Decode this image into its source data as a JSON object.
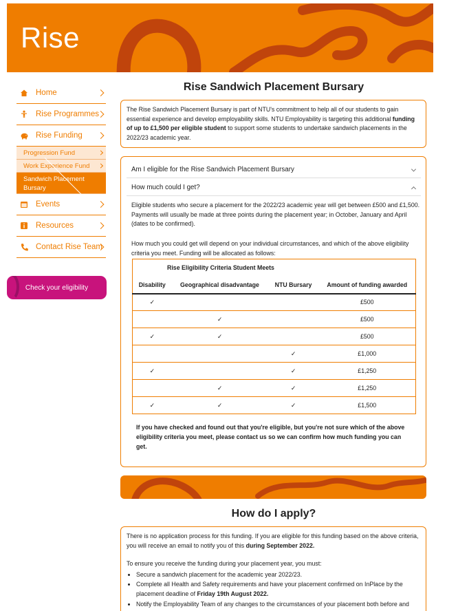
{
  "banner": {
    "title": "Rise"
  },
  "sidebar": {
    "items": [
      {
        "label": "Home",
        "icon": "home-icon"
      },
      {
        "label": "Rise Programmes",
        "icon": "person-icon"
      },
      {
        "label": "Rise Funding",
        "icon": "piggy-bank-icon"
      }
    ],
    "sub_items": [
      {
        "label": "Progression Fund"
      },
      {
        "label": "Work Experience Fund"
      },
      {
        "label": "Sandwich Placement Bursary"
      }
    ],
    "items_after": [
      {
        "label": "Events",
        "icon": "calendar-icon"
      },
      {
        "label": "Resources",
        "icon": "info-icon"
      },
      {
        "label": "Contact Rise Team",
        "icon": "phone-icon"
      }
    ],
    "cta": "Check your eligibility"
  },
  "main": {
    "title": "Rise Sandwich Placement Bursary",
    "intro_pre": "The Rise Sandwich Placement Bursary is part of NTU's commitment to help all of our students to gain essential experience and develop employability skills. NTU Employability is targeting this additional ",
    "intro_bold": "funding of up to £1,500 per eligible student",
    "intro_post": " to support some students to undertake sandwich placements in the 2022/23 academic year.",
    "accordion": [
      {
        "label": "Am I eligible for the Rise Sandwich Placement Bursary"
      },
      {
        "label": "How much could I get?"
      }
    ],
    "para1": "Eligible students who secure a placement for the 2022/23 academic year will get between £500 and £1,500. Payments will usually be made at three points during the placement year; in October, January and April (dates to be confirmed).",
    "para2": "How much you could get will depend on your individual circumstances, and which of the above eligibility criteria you meet. Funding will be allocated as follows:",
    "table": {
      "caption": "Rise Eligibility Criteria Student Meets",
      "headers": [
        "Disability",
        "Geographical disadvantage",
        "NTU Bursary",
        "Amount of funding awarded"
      ],
      "rows": [
        {
          "d": "✓",
          "g": "",
          "n": "",
          "a": "£500"
        },
        {
          "d": "",
          "g": "✓",
          "n": "",
          "a": "£500"
        },
        {
          "d": "✓",
          "g": "✓",
          "n": "",
          "a": "£500"
        },
        {
          "d": "",
          "g": "",
          "n": "✓",
          "a": "£1,000"
        },
        {
          "d": "✓",
          "g": "",
          "n": "✓",
          "a": "£1,250"
        },
        {
          "d": "",
          "g": "✓",
          "n": "✓",
          "a": "£1,250"
        },
        {
          "d": "✓",
          "g": "✓",
          "n": "✓",
          "a": "£1,500"
        }
      ]
    },
    "note": "If you have checked and found out that you're eligible, but you're not sure which of the above eligibility criteria you meet, please contact us so we can confirm how much funding you can get.",
    "apply_title": "How do I apply?",
    "apply_p1_pre": "There is no application process for this funding. If you are eligible for this funding based on the above criteria, you will receive an email to notify you of this ",
    "apply_p1_bold": "during September 2022.",
    "apply_p2": "To ensure you receive the funding during your placement year, you must:",
    "apply_list": [
      {
        "text": "Secure a sandwich placement for the academic year 2022/23.",
        "bold": ""
      },
      {
        "text": "Complete all Health and Safety requirements and have your placement confirmed on InPlace by the placement deadline of ",
        "bold": "Friday 19th August 2022."
      },
      {
        "text": "Notify the Employability Team of any changes to the circumstances of your placement both before and",
        "bold": ""
      }
    ]
  },
  "colors": {
    "accent": "#ef7d00",
    "cta": "#c8137c",
    "dark_orange": "#c0440c"
  }
}
